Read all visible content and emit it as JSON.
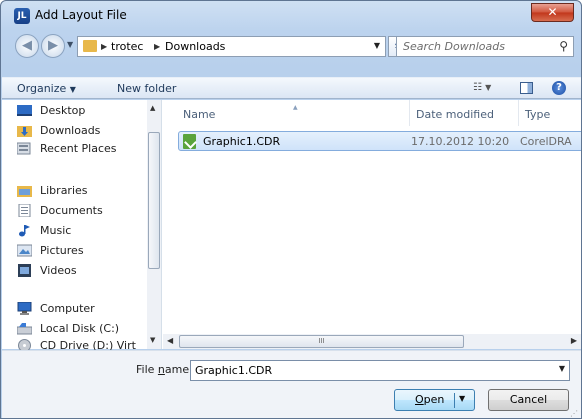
{
  "window": {
    "title": "Add Layout File",
    "app_icon": "JL",
    "close_glyph": "✕"
  },
  "address_bar": {
    "crumbs": [
      "trotec",
      "Downloads"
    ],
    "search_placeholder": "Search Downloads"
  },
  "command_bar": {
    "organize_label": "Organize",
    "new_folder_label": "New folder",
    "help_label": "?"
  },
  "nav_pane": {
    "items": [
      {
        "label": "Desktop",
        "icon": "desktop-icon"
      },
      {
        "label": "Downloads",
        "icon": "downloads-folder-icon"
      },
      {
        "label": "Recent Places",
        "icon": "recent-places-icon"
      },
      {
        "label": "Libraries",
        "icon": "libraries-icon"
      },
      {
        "label": "Documents",
        "icon": "documents-icon"
      },
      {
        "label": "Music",
        "icon": "music-icon"
      },
      {
        "label": "Pictures",
        "icon": "pictures-icon"
      },
      {
        "label": "Videos",
        "icon": "videos-icon"
      },
      {
        "label": "Computer",
        "icon": "computer-icon"
      },
      {
        "label": "Local Disk (C:)",
        "icon": "local-disk-icon"
      },
      {
        "label": "CD Drive (D:) Virt",
        "icon": "cd-drive-icon"
      }
    ]
  },
  "file_list": {
    "columns": [
      "Name",
      "Date modified",
      "Type"
    ],
    "rows": [
      {
        "name": "Graphic1.CDR",
        "date_modified": "17.10.2012 10:20",
        "type": "CorelDRA",
        "selected": true
      }
    ],
    "hscroll_grip": "III"
  },
  "footer": {
    "file_name_label_pre": "File ",
    "file_name_label_ul": "n",
    "file_name_label_post": "ame:",
    "file_name_value": "Graphic1.CDR",
    "open_label_ul": "O",
    "open_label_post": "pen",
    "cancel_label": "Cancel"
  }
}
